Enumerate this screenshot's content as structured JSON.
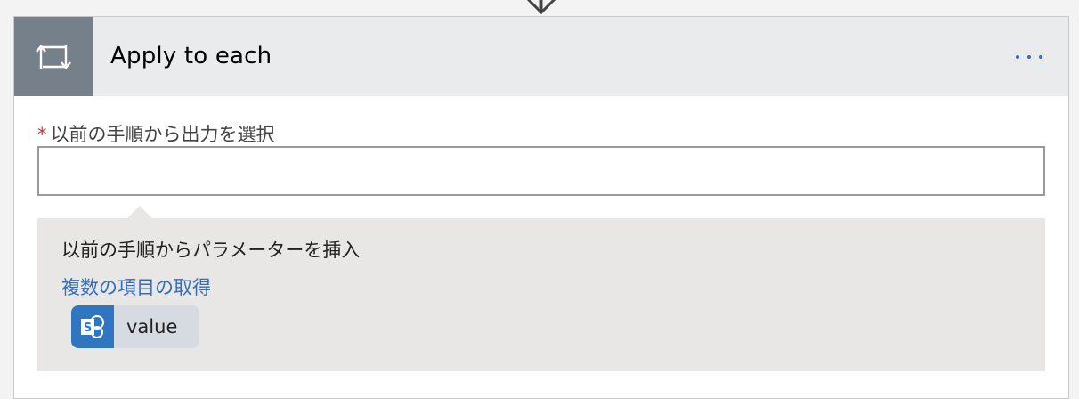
{
  "action": {
    "title": "Apply to each",
    "icon": "loop-icon",
    "more_icon": "more-options-icon"
  },
  "field": {
    "required_mark": "*",
    "label": "以前の手順から出力を選択",
    "value": ""
  },
  "dynamic_content": {
    "heading": "以前の手順からパラメーターを挿入",
    "group": "複数の項目の取得",
    "tokens": [
      {
        "label": "value",
        "icon": "sharepoint-icon"
      }
    ]
  },
  "colors": {
    "accent": "#2f6fbd",
    "header_icon_bg": "#76808a",
    "required": "#d13438",
    "sharepoint": "#2f75bf"
  }
}
